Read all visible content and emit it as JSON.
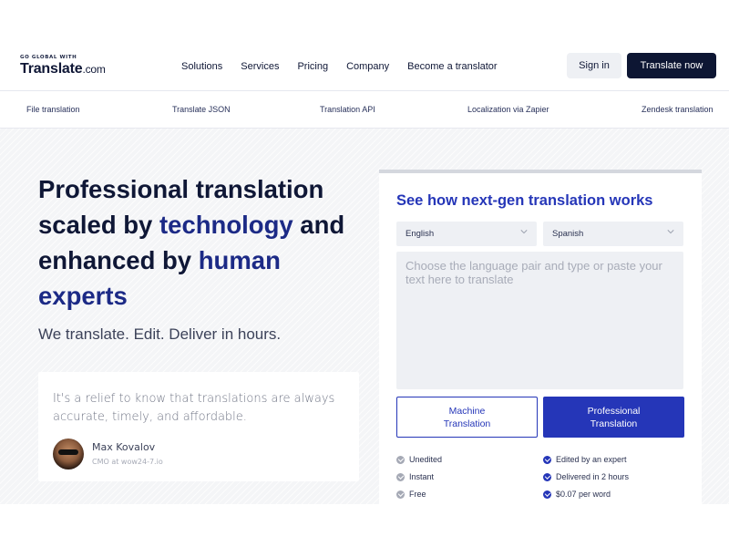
{
  "logo": {
    "tagline": "GO GLOBAL WITH",
    "name": "Translate",
    "suffix": ".com"
  },
  "nav": {
    "items": [
      "Solutions",
      "Services",
      "Pricing",
      "Company",
      "Become a translator"
    ],
    "sign_in": "Sign in",
    "cta": "Translate now"
  },
  "subnav": {
    "items": [
      "File translation",
      "Translate JSON",
      "Translation API",
      "Localization via Zapier",
      "Zendesk translation"
    ]
  },
  "hero": {
    "headline_1": "Professional translation scaled by ",
    "headline_hl1": "technology",
    "headline_2": " and enhanced by ",
    "headline_hl2": "human experts",
    "subhead": "We translate. Edit. Deliver in hours."
  },
  "testimonial": {
    "quote": "It's a relief to know that translations are always accurate, timely, and affordable.",
    "name": "Max Kovalov",
    "role": "CMO at wow24-7.io"
  },
  "widget": {
    "title": "See how next-gen translation works",
    "source_lang": "English",
    "target_lang": "Spanish",
    "placeholder": "Choose the language pair and type or paste your text here to translate",
    "machine_line1": "Machine",
    "machine_line2": "Translation",
    "pro_line1": "Professional",
    "pro_line2": "Translation",
    "machine_features": [
      "Unedited",
      "Instant",
      "Free"
    ],
    "pro_features": [
      "Edited by an expert",
      "Delivered in 2 hours",
      "$0.07 per word"
    ]
  },
  "colors": {
    "brand_dark": "#0d1633",
    "accent_blue": "#2536b8",
    "highlight_navy": "#1c2a86"
  }
}
